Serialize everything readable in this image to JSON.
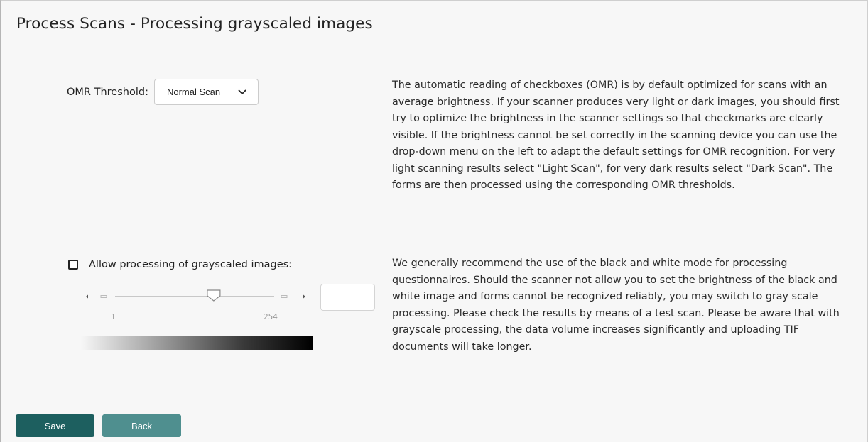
{
  "page": {
    "title": "Process Scans - Processing grayscaled images"
  },
  "omr": {
    "label": "OMR Threshold:",
    "selected": "Normal Scan",
    "description": "The automatic reading of checkboxes (OMR) is by default optimized for scans with an average brightness. If your scanner produces very light or dark images, you should first try to optimize the brightness in the scanner settings so that checkmarks are clearly visible. If the brightness cannot be set correctly in the scanning device you can use the drop-down menu on the left to adapt the default settings for OMR recognition. For very light scanning results select \"Light Scan\", for very dark results select \"Dark Scan\". The forms are then processed using the corresponding OMR thresholds."
  },
  "grayscale": {
    "checkbox_label": "Allow processing of grayscaled images:",
    "checked": false,
    "slider_min": "1",
    "slider_max": "254",
    "slider_position_fraction": 0.62,
    "value": "",
    "description": "We generally recommend the use of the black and white mode for processing questionnaires. Should the scanner not allow you to set the brightness of the black and white image and forms cannot be recognized reliably, you may switch to gray scale processing. Please check the results by means of a test scan. Please be aware that with grayscale processing, the data volume increases significantly and uploading TIF documents will take longer."
  },
  "actions": {
    "save_label": "Save",
    "back_label": "Back"
  },
  "colors": {
    "save_button": "#1d5f5f",
    "back_button": "#4f8f8f",
    "background": "#f7f7f7"
  },
  "icons": {
    "dropdown": "chevron-down-icon",
    "slider_left": "caret-left-icon",
    "slider_right": "caret-right-icon"
  }
}
